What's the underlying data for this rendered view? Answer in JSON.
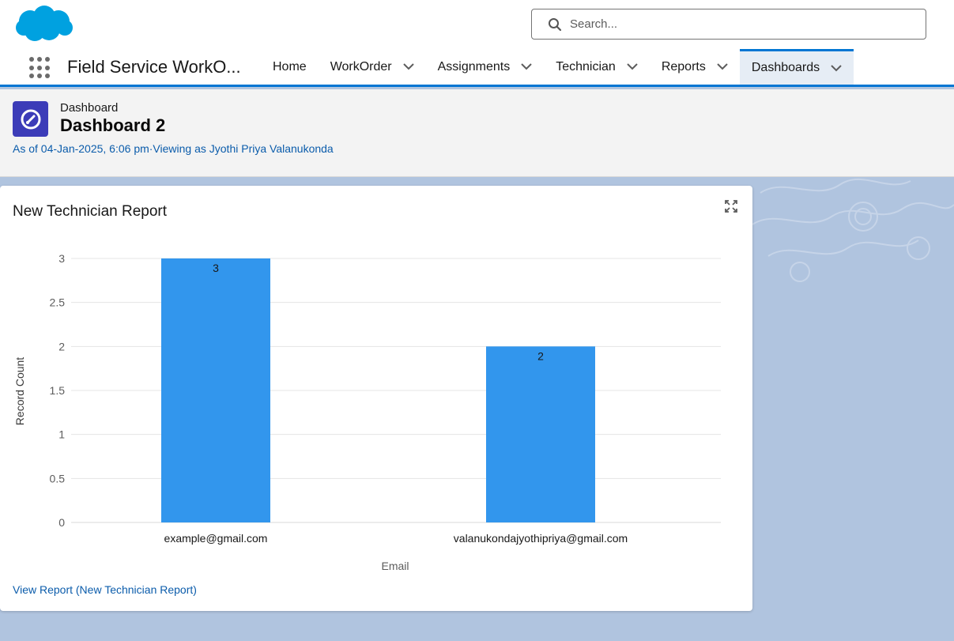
{
  "header": {
    "search_placeholder": "Search..."
  },
  "nav": {
    "app_name": "Field Service WorkO...",
    "items": [
      {
        "label": "Home",
        "has_menu": false,
        "active": false
      },
      {
        "label": "WorkOrder",
        "has_menu": true,
        "active": false
      },
      {
        "label": "Assignments",
        "has_menu": true,
        "active": false
      },
      {
        "label": "Technician",
        "has_menu": true,
        "active": false
      },
      {
        "label": "Reports",
        "has_menu": true,
        "active": false
      },
      {
        "label": "Dashboards",
        "has_menu": true,
        "active": true
      }
    ]
  },
  "page": {
    "object_type": "Dashboard",
    "title": "Dashboard 2",
    "meta": "As of 04-Jan-2025, 6:06 pm·Viewing as Jyothi Priya Valanukonda"
  },
  "card": {
    "title": "New Technician Report",
    "view_report_link": "View Report (New Technician Report)"
  },
  "colors": {
    "accent": "#0176d3",
    "bar": "#3296ed",
    "link": "#0b5cab",
    "dashboard_icon": "#3c3cb8",
    "brand_cloud": "#00a1e0"
  },
  "icons": [
    "salesforce-cloud-logo",
    "search-icon",
    "app-launcher-icon",
    "chevron-down-icon",
    "dashboard-gauge-icon",
    "expand-icon"
  ],
  "chart_data": {
    "type": "bar",
    "categories": [
      "example@gmail.com",
      "valanukondajyothipriya@gmail.com"
    ],
    "values": [
      3,
      2
    ],
    "data_labels": [
      "3",
      "2"
    ],
    "xlabel": "Email",
    "ylabel": "Record Count",
    "ylim": [
      0,
      3
    ],
    "yticks": [
      "0",
      "0.5",
      "1",
      "1.5",
      "2",
      "2.5",
      "3"
    ],
    "grid": true
  }
}
